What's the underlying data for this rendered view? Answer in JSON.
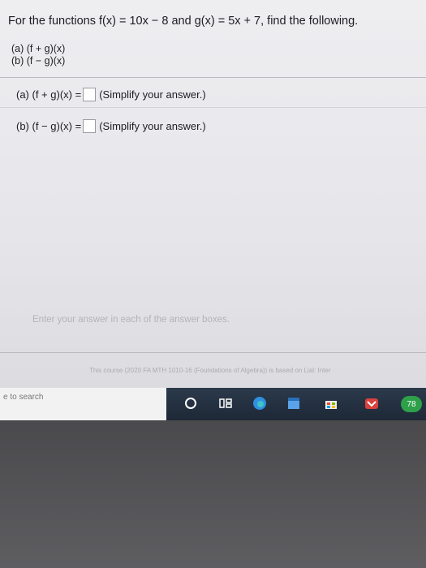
{
  "problem": {
    "statement": "For the functions f(x) = 10x − 8 and g(x) = 5x + 7, find the following.",
    "parts": [
      "(a) (f + g)(x)",
      "(b) (f − g)(x)"
    ]
  },
  "answers": [
    {
      "label": "(a) (f + g)(x) =",
      "value": "",
      "hint": "(Simplify your answer.)"
    },
    {
      "label": "(b) (f − g)(x) =",
      "value": "",
      "hint": "(Simplify your answer.)"
    }
  ],
  "instruction": "Enter your answer in each of the answer boxes.",
  "footer": "This course (2020 FA MTH 1010-16 (Foundations of Algebra)) is based on Lial: Inter",
  "taskbar": {
    "search_placeholder": "e to search",
    "badge": "78",
    "icons": [
      "cortana-circle-icon",
      "task-view-icon",
      "edge-icon",
      "notepad-icon",
      "store-icon",
      "mail-icon",
      "app-badge-icon"
    ]
  }
}
